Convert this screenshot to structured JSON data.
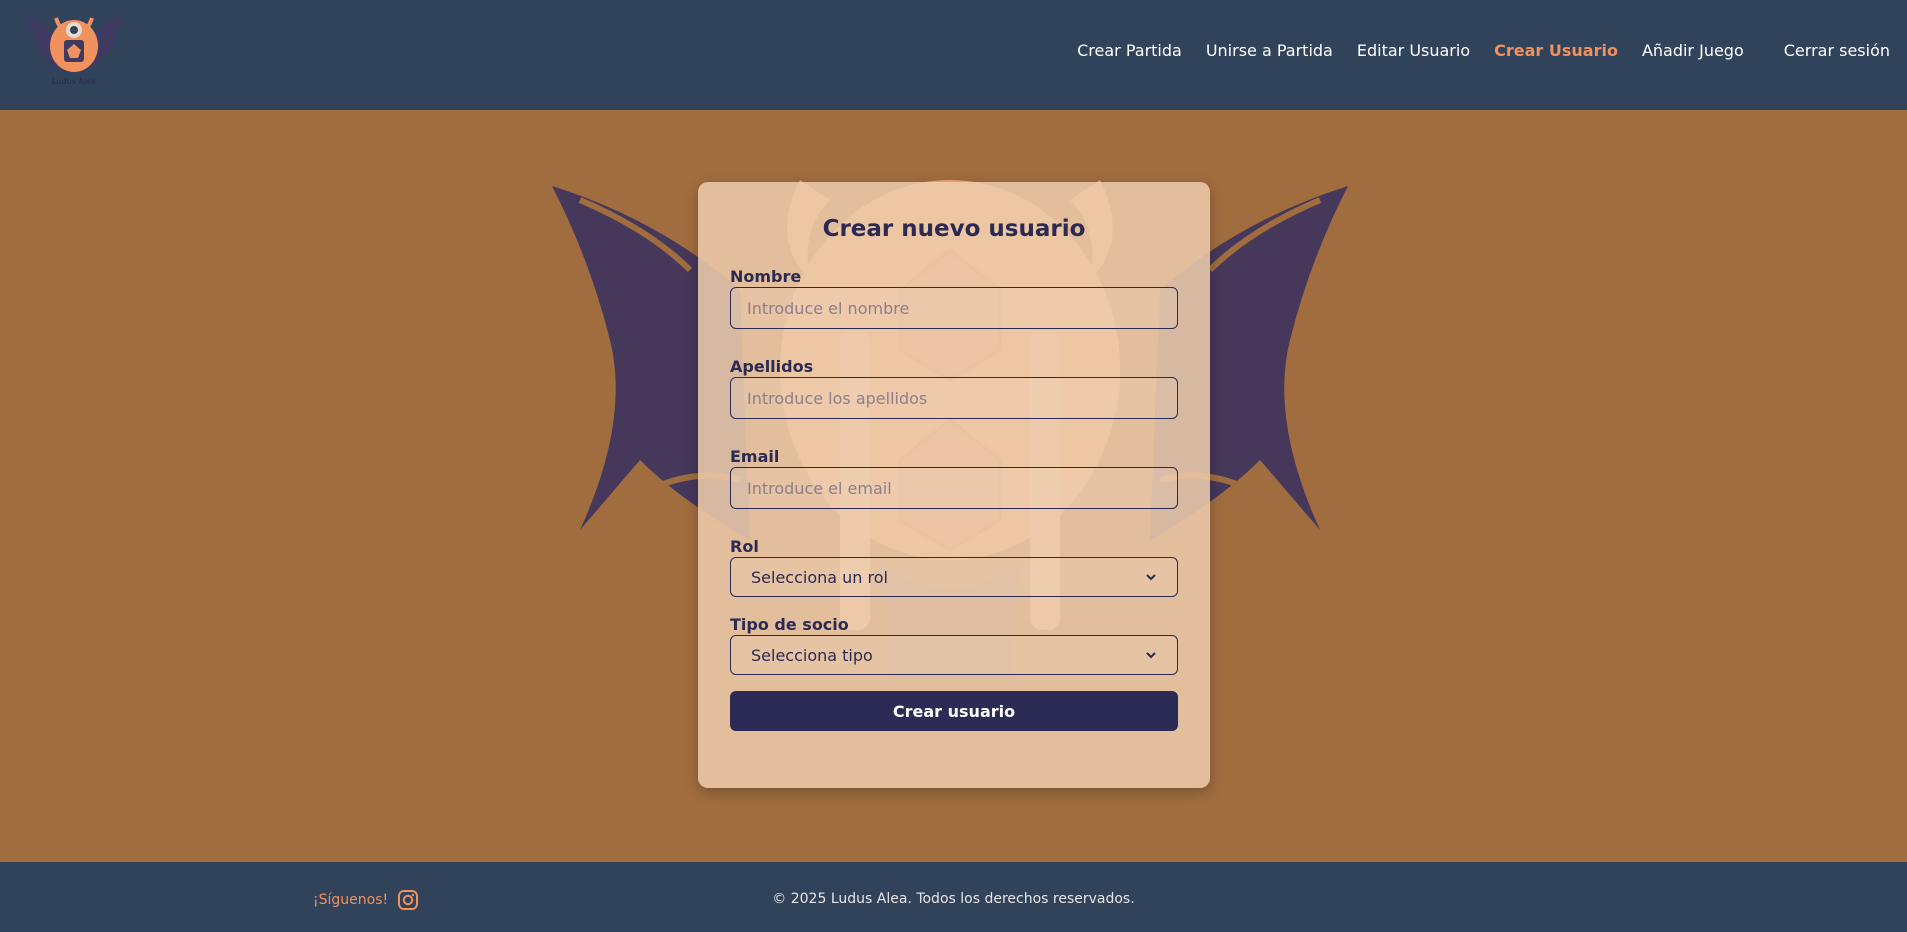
{
  "header": {
    "logo_text": "Ludus Alea",
    "nav": [
      {
        "label": "Crear Partida",
        "active": false
      },
      {
        "label": "Unirse a Partida",
        "active": false
      },
      {
        "label": "Editar Usuario",
        "active": false
      },
      {
        "label": "Crear Usuario",
        "active": true
      },
      {
        "label": "Añadir Juego",
        "active": false
      }
    ],
    "logout_label": "Cerrar sesión"
  },
  "form": {
    "title": "Crear nuevo usuario",
    "name_label": "Nombre",
    "name_placeholder": "Introduce el nombre",
    "surname_label": "Apellidos",
    "surname_placeholder": "Introduce los apellidos",
    "email_label": "Email",
    "email_placeholder": "Introduce el email",
    "role_label": "Rol",
    "role_value": "Selecciona un rol",
    "member_label": "Tipo de socio",
    "member_value": "Selecciona tipo",
    "submit_label": "Crear usuario"
  },
  "footer": {
    "follow_label": "¡Síguenos!",
    "copyright": "© 2025 Ludus Alea. Todos los derechos reservados."
  },
  "colors": {
    "header_bg": "#31425b",
    "page_bg": "#a16d3f",
    "accent": "#f0915e",
    "primary": "#2c2b55",
    "card_bg": "#ecc9aa"
  },
  "icons": {
    "logo": "ludus-alea-logo",
    "instagram": "instagram-icon",
    "select_chevron": "chevron-down-icon",
    "background_art": "winged-dice-emblem"
  }
}
